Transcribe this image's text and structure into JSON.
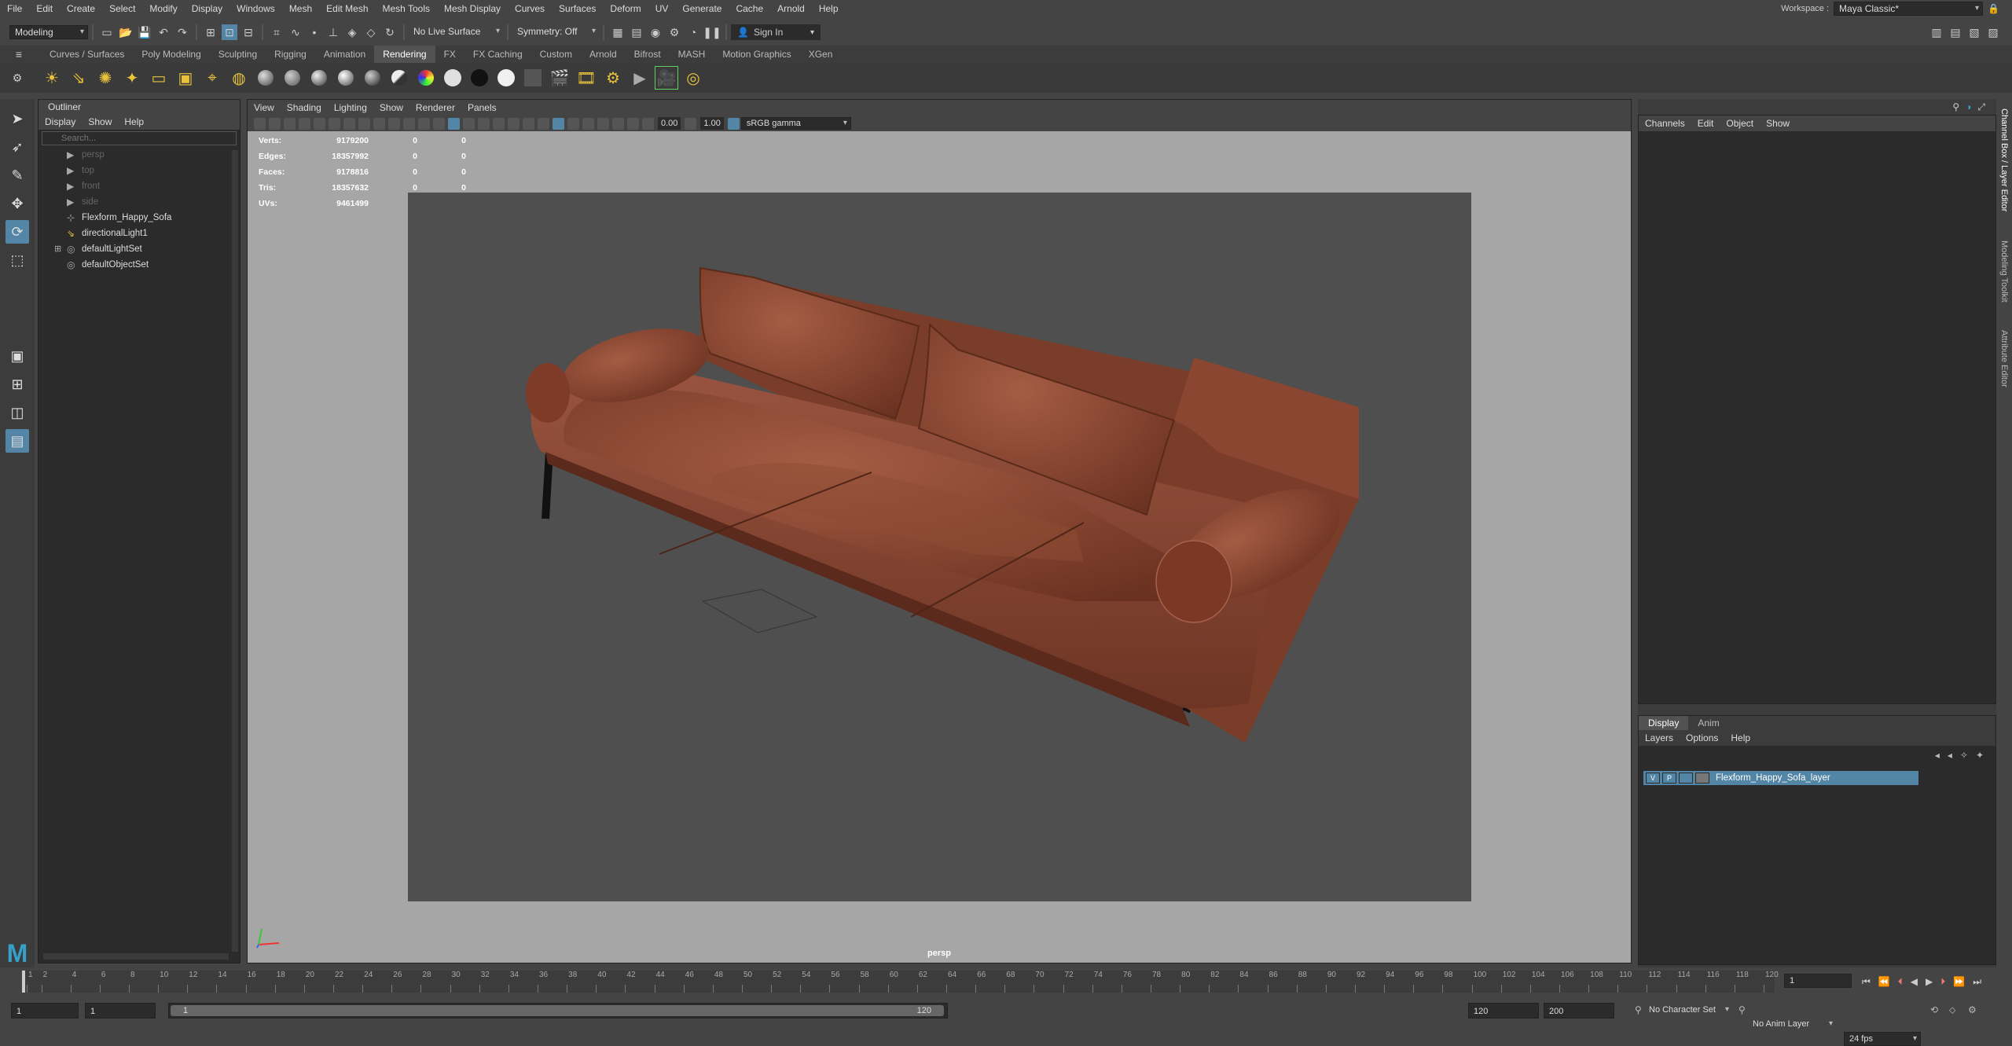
{
  "menubar": {
    "items": [
      "File",
      "Edit",
      "Create",
      "Select",
      "Modify",
      "Display",
      "Windows",
      "Mesh",
      "Edit Mesh",
      "Mesh Tools",
      "Mesh Display",
      "Curves",
      "Surfaces",
      "Deform",
      "UV",
      "Generate",
      "Cache",
      "Arnold",
      "Help"
    ],
    "workspace_label": "Workspace :",
    "workspace_value": "Maya Classic*"
  },
  "statusline": {
    "mode": "Modeling",
    "live_surface": "No Live Surface",
    "symmetry": "Symmetry: Off",
    "sign_in": "Sign In"
  },
  "shelf": {
    "tabs": [
      "Curves / Surfaces",
      "Poly Modeling",
      "Sculpting",
      "Rigging",
      "Animation",
      "Rendering",
      "FX",
      "FX Caching",
      "Custom",
      "Arnold",
      "Bifrost",
      "MASH",
      "Motion Graphics",
      "XGen"
    ],
    "active_tab": "Rendering"
  },
  "outliner": {
    "title": "Outliner",
    "menu": [
      "Display",
      "Show",
      "Help"
    ],
    "search_placeholder": "Search...",
    "items": [
      {
        "label": "persp",
        "icon": "camera-icon",
        "dim": true
      },
      {
        "label": "top",
        "icon": "camera-icon",
        "dim": true
      },
      {
        "label": "front",
        "icon": "camera-icon",
        "dim": true
      },
      {
        "label": "side",
        "icon": "camera-icon",
        "dim": true
      },
      {
        "label": "Flexform_Happy_Sofa",
        "icon": "transform-icon",
        "dim": false
      },
      {
        "label": "directionalLight1",
        "icon": "light-icon",
        "dim": false
      },
      {
        "label": "defaultLightSet",
        "icon": "set-icon",
        "dim": false,
        "expand": true
      },
      {
        "label": "defaultObjectSet",
        "icon": "set-icon",
        "dim": false
      }
    ]
  },
  "viewport": {
    "menu": [
      "View",
      "Shading",
      "Lighting",
      "Show",
      "Renderer",
      "Panels"
    ],
    "exposure": "0.00",
    "gamma": "1.00",
    "color_space": "sRGB gamma",
    "camera_label": "persp",
    "hud": [
      {
        "key": "Verts:",
        "value": "9179200",
        "sel": "0",
        "comp": "0"
      },
      {
        "key": "Edges:",
        "value": "18357992",
        "sel": "0",
        "comp": "0"
      },
      {
        "key": "Faces:",
        "value": "9178816",
        "sel": "0",
        "comp": "0"
      },
      {
        "key": "Tris:",
        "value": "18357632",
        "sel": "0",
        "comp": "0"
      },
      {
        "key": "UVs:",
        "value": "9461499",
        "sel": "0",
        "comp": "0"
      }
    ]
  },
  "channelbox": {
    "menu": [
      "Channels",
      "Edit",
      "Object",
      "Show"
    ]
  },
  "layereditor": {
    "tabs": [
      "Display",
      "Anim"
    ],
    "menu": [
      "Layers",
      "Options",
      "Help"
    ],
    "layer_name": "Flexform_Happy_Sofa_layer",
    "layer_v": "V",
    "layer_p": "P"
  },
  "sidetabs": [
    "Channel Box / Layer Editor",
    "Modeling Toolkit",
    "Attribute Editor"
  ],
  "timeline": {
    "ticks": [
      "1",
      "2",
      "4",
      "6",
      "8",
      "10",
      "12",
      "14",
      "16",
      "18",
      "20",
      "22",
      "24",
      "26",
      "28",
      "30",
      "32",
      "34",
      "36",
      "38",
      "40",
      "42",
      "44",
      "46",
      "48",
      "50",
      "52",
      "54",
      "56",
      "58",
      "60",
      "62",
      "64",
      "66",
      "68",
      "70",
      "72",
      "74",
      "76",
      "78",
      "80",
      "82",
      "84",
      "86",
      "88",
      "90",
      "92",
      "94",
      "96",
      "98",
      "100",
      "102",
      "104",
      "106",
      "108",
      "110",
      "112",
      "114",
      "116",
      "118",
      "120"
    ],
    "current_frame": "1"
  },
  "range": {
    "start": "1",
    "anim_start": "1",
    "slider_start": "1",
    "slider_end": "120",
    "end": "120",
    "anim_end": "200",
    "character_set": "No Character Set",
    "anim_layer": "No Anim Layer",
    "fps": "24 fps"
  },
  "colors": {
    "accent": "#5285a6",
    "leather": "#8a4a33",
    "background_gray": "#a6a6a6"
  }
}
